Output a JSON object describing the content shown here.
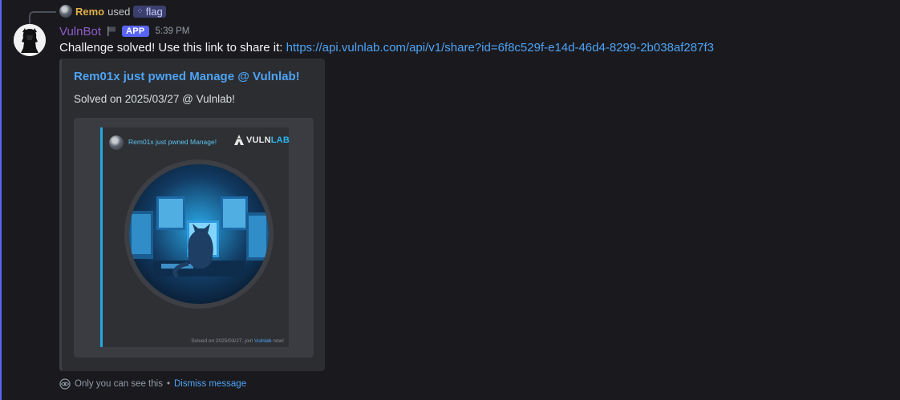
{
  "reply": {
    "user": "Remo",
    "used": "used",
    "command": "flag",
    "command_icon": "slash-command-icon"
  },
  "message": {
    "author": "VulnBot",
    "author_color": "#8e5cc7",
    "badge": "APP",
    "timestamp": "5:39 PM",
    "text": "Challenge solved! Use this link to share it: ",
    "link": "https://api.vulnlab.com/api/v1/share?id=6f8c529f-e14d-46d4-8299-2b038af287f3"
  },
  "embed": {
    "title": "Rem01x just pwned Manage @ Vulnlab!",
    "description": "Solved on 2025/03/27 @ Vulnlab!",
    "image": {
      "title": "Rem01x just pwned Manage!",
      "logo_prefix": "VULN",
      "logo_suffix": "LAB",
      "footer_prefix": "Solved on 2025/03/27, join ",
      "footer_link": "Vulnlab",
      "footer_suffix": " now!"
    }
  },
  "ephemeral": {
    "notice": "Only you can see this",
    "separator": " • ",
    "dismiss": "Dismiss message"
  },
  "colors": {
    "accent": "#5865f2",
    "link": "#4ea3f5",
    "background": "#1a1a1e"
  }
}
